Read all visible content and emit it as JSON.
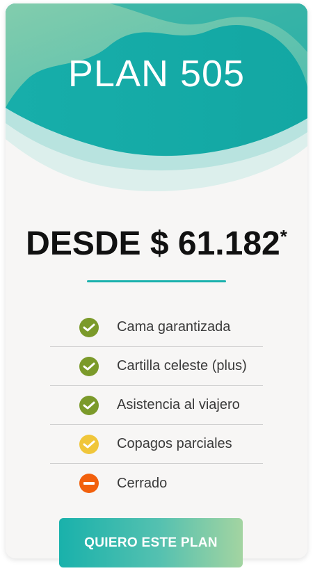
{
  "plan": {
    "title": "PLAN 505",
    "price_prefix": "DESDE $ ",
    "price_value": "61.182",
    "price_mark": "*"
  },
  "features": [
    {
      "label": "Cama garantizada",
      "status": "included",
      "icon": "check-icon",
      "color": "#7b9a2a"
    },
    {
      "label": "Cartilla celeste (plus)",
      "status": "included",
      "icon": "check-icon",
      "color": "#7b9a2a"
    },
    {
      "label": "Asistencia al viajero",
      "status": "included",
      "icon": "check-icon",
      "color": "#7b9a2a"
    },
    {
      "label": "Copagos parciales",
      "status": "partial",
      "icon": "check-icon",
      "color": "#f0c63a"
    },
    {
      "label": "Cerrado",
      "status": "not-included",
      "icon": "minus-icon",
      "color": "#f2600c"
    }
  ],
  "cta": {
    "label": "QUIERO ESTE PLAN"
  },
  "colors": {
    "accent": "#1ab1ad",
    "header_teal": "#15aeaa",
    "header_green": "#6cc3a6"
  }
}
